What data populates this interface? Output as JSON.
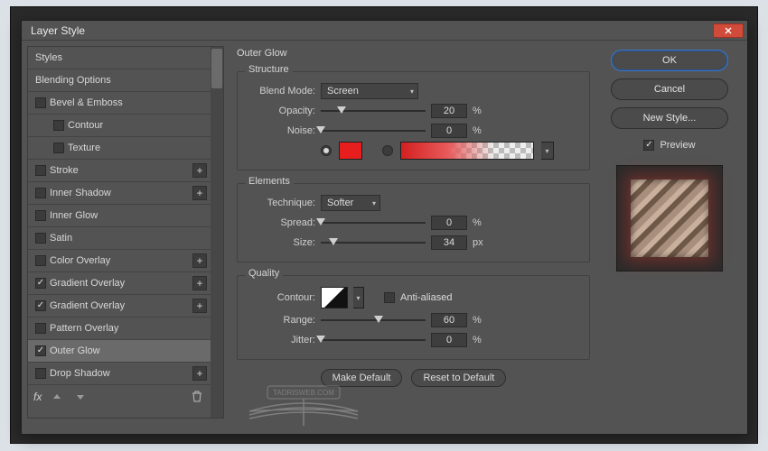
{
  "dialog": {
    "title": "Layer Style"
  },
  "left": {
    "header": "Styles",
    "blending": "Blending Options",
    "items": [
      {
        "label": "Bevel & Emboss",
        "checked": false,
        "fx": false
      },
      {
        "label": "Contour",
        "checked": false,
        "fx": false,
        "indent": true
      },
      {
        "label": "Texture",
        "checked": false,
        "fx": false,
        "indent": true
      },
      {
        "label": "Stroke",
        "checked": false,
        "fx": true
      },
      {
        "label": "Inner Shadow",
        "checked": false,
        "fx": true
      },
      {
        "label": "Inner Glow",
        "checked": false,
        "fx": false
      },
      {
        "label": "Satin",
        "checked": false,
        "fx": false
      },
      {
        "label": "Color Overlay",
        "checked": false,
        "fx": true
      },
      {
        "label": "Gradient Overlay",
        "checked": true,
        "fx": true
      },
      {
        "label": "Gradient Overlay",
        "checked": true,
        "fx": true
      },
      {
        "label": "Pattern Overlay",
        "checked": false,
        "fx": false
      },
      {
        "label": "Outer Glow",
        "checked": true,
        "fx": false,
        "selected": true
      },
      {
        "label": "Drop Shadow",
        "checked": false,
        "fx": true
      }
    ],
    "footer_fx": "fx"
  },
  "mid": {
    "title": "Outer Glow",
    "structure": {
      "title": "Structure",
      "blend_mode_label": "Blend Mode:",
      "blend_mode_value": "Screen",
      "opacity_label": "Opacity:",
      "opacity_value": "20",
      "opacity_unit": "%",
      "noise_label": "Noise:",
      "noise_value": "0",
      "noise_unit": "%",
      "color": "#e61e1e"
    },
    "elements": {
      "title": "Elements",
      "technique_label": "Technique:",
      "technique_value": "Softer",
      "spread_label": "Spread:",
      "spread_value": "0",
      "spread_unit": "%",
      "size_label": "Size:",
      "size_value": "34",
      "size_unit": "px"
    },
    "quality": {
      "title": "Quality",
      "contour_label": "Contour:",
      "aa_label": "Anti-aliased",
      "range_label": "Range:",
      "range_value": "60",
      "range_unit": "%",
      "jitter_label": "Jitter:",
      "jitter_value": "0",
      "jitter_unit": "%"
    },
    "buttons": {
      "make_default": "Make Default",
      "reset": "Reset to Default"
    },
    "watermark": "TADRISWEB.COM"
  },
  "right": {
    "ok": "OK",
    "cancel": "Cancel",
    "new_style": "New Style...",
    "preview": "Preview"
  }
}
